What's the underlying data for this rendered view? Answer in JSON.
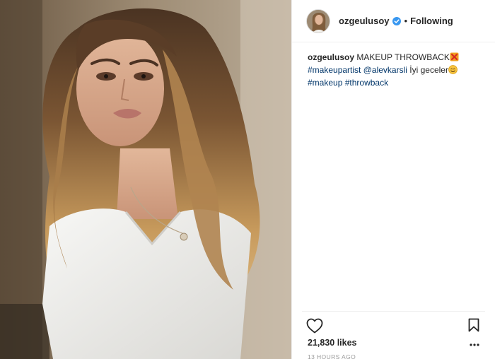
{
  "post": {
    "image_alt": "Woman with long wavy highlighted hair in white t-shirt",
    "header": {
      "username": "ozgeulusoy",
      "separator": "•",
      "follow_label": "Following"
    },
    "caption": {
      "username": "ozgeulusoy",
      "text_1": " MAKEUP THROWBACK",
      "hashtag_1": "#makeupartist",
      "mention": "@alevkarsli",
      "text_2": " İyi geceler",
      "hashtag_2": "#makeup",
      "hashtag_3": "#throwback"
    },
    "likes": "21,830 likes",
    "timestamp": "13 HOURS AGO"
  },
  "colors": {
    "link": "#003569",
    "verified": "#3897f0",
    "text": "#262626",
    "muted": "#999999",
    "divider": "#efefef"
  },
  "icons": {
    "verified": "verified-badge-icon",
    "like": "heart-icon",
    "save": "bookmark-icon",
    "more": "more-options-icon",
    "emoji_1": "anger-symbol-emoji",
    "emoji_2": "smiling-face-emoji"
  }
}
